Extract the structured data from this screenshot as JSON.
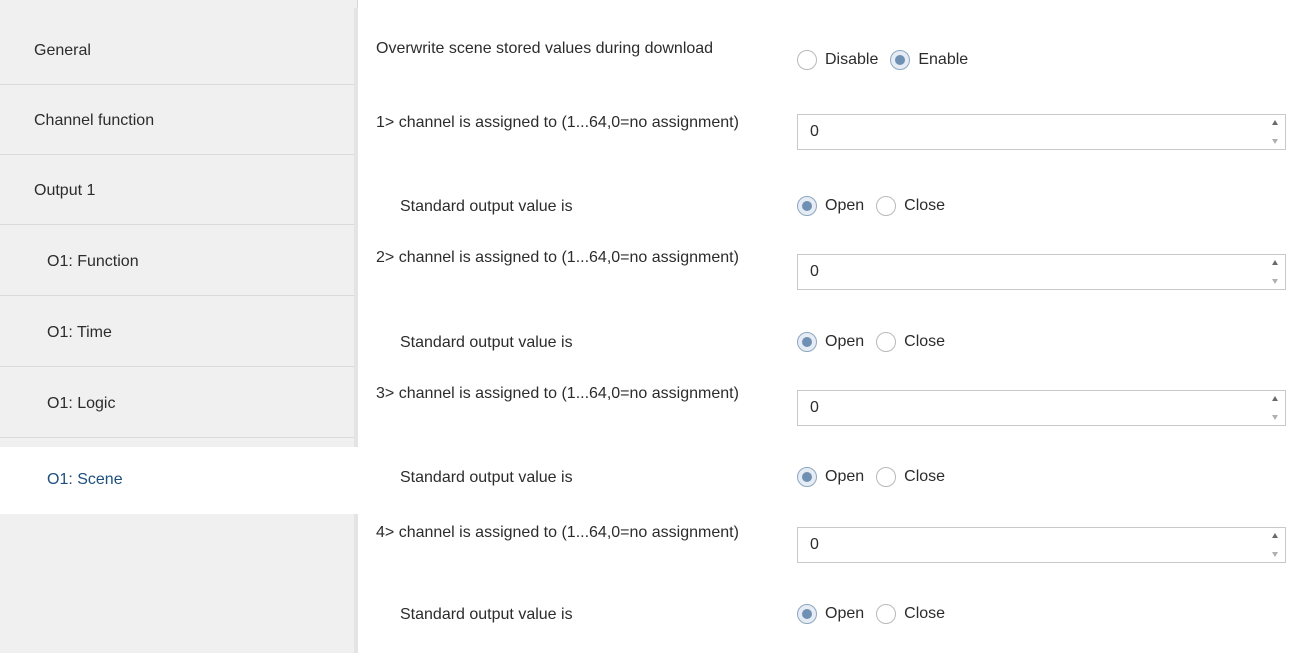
{
  "sidebar": {
    "items": [
      {
        "label": "General"
      },
      {
        "label": "Channel function"
      },
      {
        "label": "Output 1"
      },
      {
        "label": "O1: Function"
      },
      {
        "label": "O1: Time"
      },
      {
        "label": "O1: Logic"
      },
      {
        "label": "O1: Scene"
      }
    ]
  },
  "params": {
    "overwrite": {
      "label": "Overwrite scene stored values during download",
      "options": [
        "Disable",
        "Enable"
      ],
      "selected": "Enable"
    },
    "channels": [
      {
        "assign_label": "1> channel is assigned to (1...64,0=no assignment)",
        "value": "0",
        "output_label": "Standard output value is",
        "options": [
          "Open",
          "Close"
        ],
        "selected": "Open"
      },
      {
        "assign_label": "2> channel is assigned to (1...64,0=no assignment)",
        "value": "0",
        "output_label": "Standard output value is",
        "options": [
          "Open",
          "Close"
        ],
        "selected": "Open"
      },
      {
        "assign_label": "3> channel is assigned to (1...64,0=no assignment)",
        "value": "0",
        "output_label": "Standard output value is",
        "options": [
          "Open",
          "Close"
        ],
        "selected": "Open"
      },
      {
        "assign_label": "4> channel is assigned to (1...64,0=no assignment)",
        "value": "0",
        "output_label": "Standard output value is",
        "options": [
          "Open",
          "Close"
        ],
        "selected": "Open"
      }
    ]
  },
  "colors": {
    "active_nav_text": "#1e4f7c",
    "radio_checked": "#6f8fb3"
  }
}
